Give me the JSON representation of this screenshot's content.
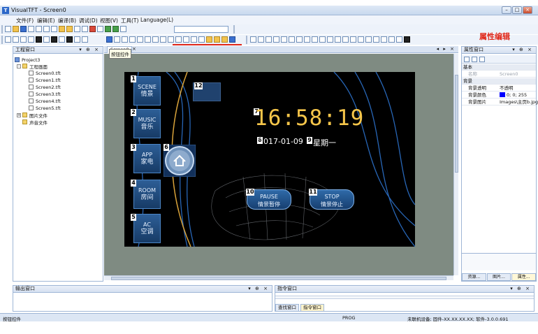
{
  "window": {
    "title": "VisualTFT - Screen0",
    "app_icon": "T"
  },
  "menu": [
    "文件(F)",
    "编辑(E)",
    "编译(B)",
    "调试(D)",
    "视图(V)",
    "工具(T)",
    "Language(L)"
  ],
  "annotation": {
    "text": "属性编辑",
    "color": "#e0281a"
  },
  "tooltip": "按钮控件",
  "project_panel": {
    "title": "工程窗口",
    "tree": [
      {
        "label": "Project3",
        "level": 0,
        "icon": "project-icon"
      },
      {
        "label": "工程画面",
        "level": 1,
        "icon": "folder-icon",
        "expander": "-"
      },
      {
        "label": "Screen0.tft",
        "level": 2,
        "icon": "file-icon"
      },
      {
        "label": "Screen1.tft",
        "level": 2,
        "icon": "file-icon"
      },
      {
        "label": "Screen2.tft",
        "level": 2,
        "icon": "file-icon"
      },
      {
        "label": "Screen3.tft",
        "level": 2,
        "icon": "file-icon"
      },
      {
        "label": "Screen4.tft",
        "level": 2,
        "icon": "file-icon"
      },
      {
        "label": "Screen5.tft",
        "level": 2,
        "icon": "file-icon"
      },
      {
        "label": "图片文件",
        "level": 1,
        "icon": "folder-icon",
        "expander": "+"
      },
      {
        "label": "声音文件",
        "level": 1,
        "icon": "folder-icon"
      }
    ]
  },
  "doc_tab": {
    "label": "Screen0",
    "close": "×"
  },
  "screen": {
    "buttons": [
      {
        "num": "1",
        "en": "SCENE",
        "zh": "情景"
      },
      {
        "num": "2",
        "en": "MUSIC",
        "zh": "音乐"
      },
      {
        "num": "3",
        "en": "APP",
        "zh": "家电"
      },
      {
        "num": "4",
        "en": "ROOM",
        "zh": "房间"
      },
      {
        "num": "5",
        "en": "AC",
        "zh": "空调"
      }
    ],
    "home_num": "6",
    "clock_num": "7",
    "clock": "16:58:19",
    "date_num": "8",
    "date": "2017-01-09",
    "weekday_num": "9",
    "weekday": "星期一",
    "pause": {
      "num": "10",
      "en": "PAUSE",
      "zh": "情景暂停"
    },
    "stop": {
      "num": "11",
      "en": "STOP",
      "zh": "情景停止"
    },
    "box_num": "12",
    "clock_color": "#f6c64a"
  },
  "props_panel": {
    "title": "属性窗口",
    "rows": [
      {
        "type": "group",
        "key": "基本"
      },
      {
        "type": "row",
        "key": "名称",
        "value": "Screen0",
        "muted": true
      },
      {
        "type": "group",
        "key": "背景"
      },
      {
        "type": "row",
        "key": "背景透明",
        "value": "不透明"
      },
      {
        "type": "row",
        "key": "背景颜色",
        "value": "0; 0; 255",
        "swatch": "#0000ff"
      },
      {
        "type": "row",
        "key": "背景图片",
        "value": "Images\\主页b.jpg"
      }
    ],
    "tabs": [
      "资源...",
      "图片...",
      "属性..."
    ]
  },
  "output_panel": {
    "title": "输出窗口"
  },
  "command_panel": {
    "title": "指令窗口",
    "tabs": [
      "查找窗口",
      "指令窗口"
    ]
  },
  "status": {
    "left": "按钮控件",
    "mode": "PROG",
    "device": "未联机设备; 固件-XX.XX.XX.XX; 软件-3.0.0.691"
  }
}
